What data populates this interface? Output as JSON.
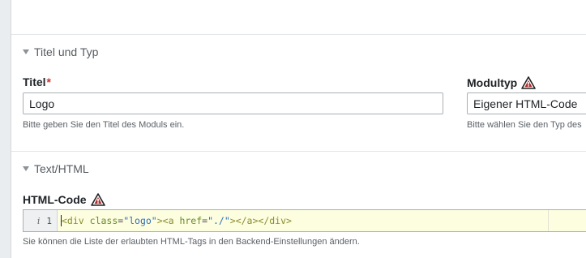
{
  "sections": [
    {
      "title": "Titel und Typ",
      "fields": {
        "title": {
          "label": "Titel",
          "required_mark": "*",
          "value": "Logo",
          "help": "Bitte geben Sie den Titel des Moduls ein."
        },
        "module_type": {
          "label": "Modultyp",
          "value": "Eigener HTML-Code",
          "help": "Bitte wählen Sie den Typ des"
        }
      }
    },
    {
      "title": "Text/HTML",
      "fields": {
        "html_code": {
          "label": "HTML-Code",
          "line_number": "1",
          "code": {
            "tag_open": "<div",
            "attr_class": " class",
            "eq": "=",
            "val_class": "\"logo\"",
            "tag_close_a_open": "><a",
            "attr_href": " href",
            "val_href": "\"./\"",
            "tail": "></a></div>"
          },
          "help": "Sie können die Liste der erlaubten HTML-Tags in den Backend-Einstellungen ändern."
        }
      }
    }
  ],
  "colors": {
    "required": "#cc3333",
    "warning": "#b02a2a",
    "code_background": "#fdfde0"
  }
}
